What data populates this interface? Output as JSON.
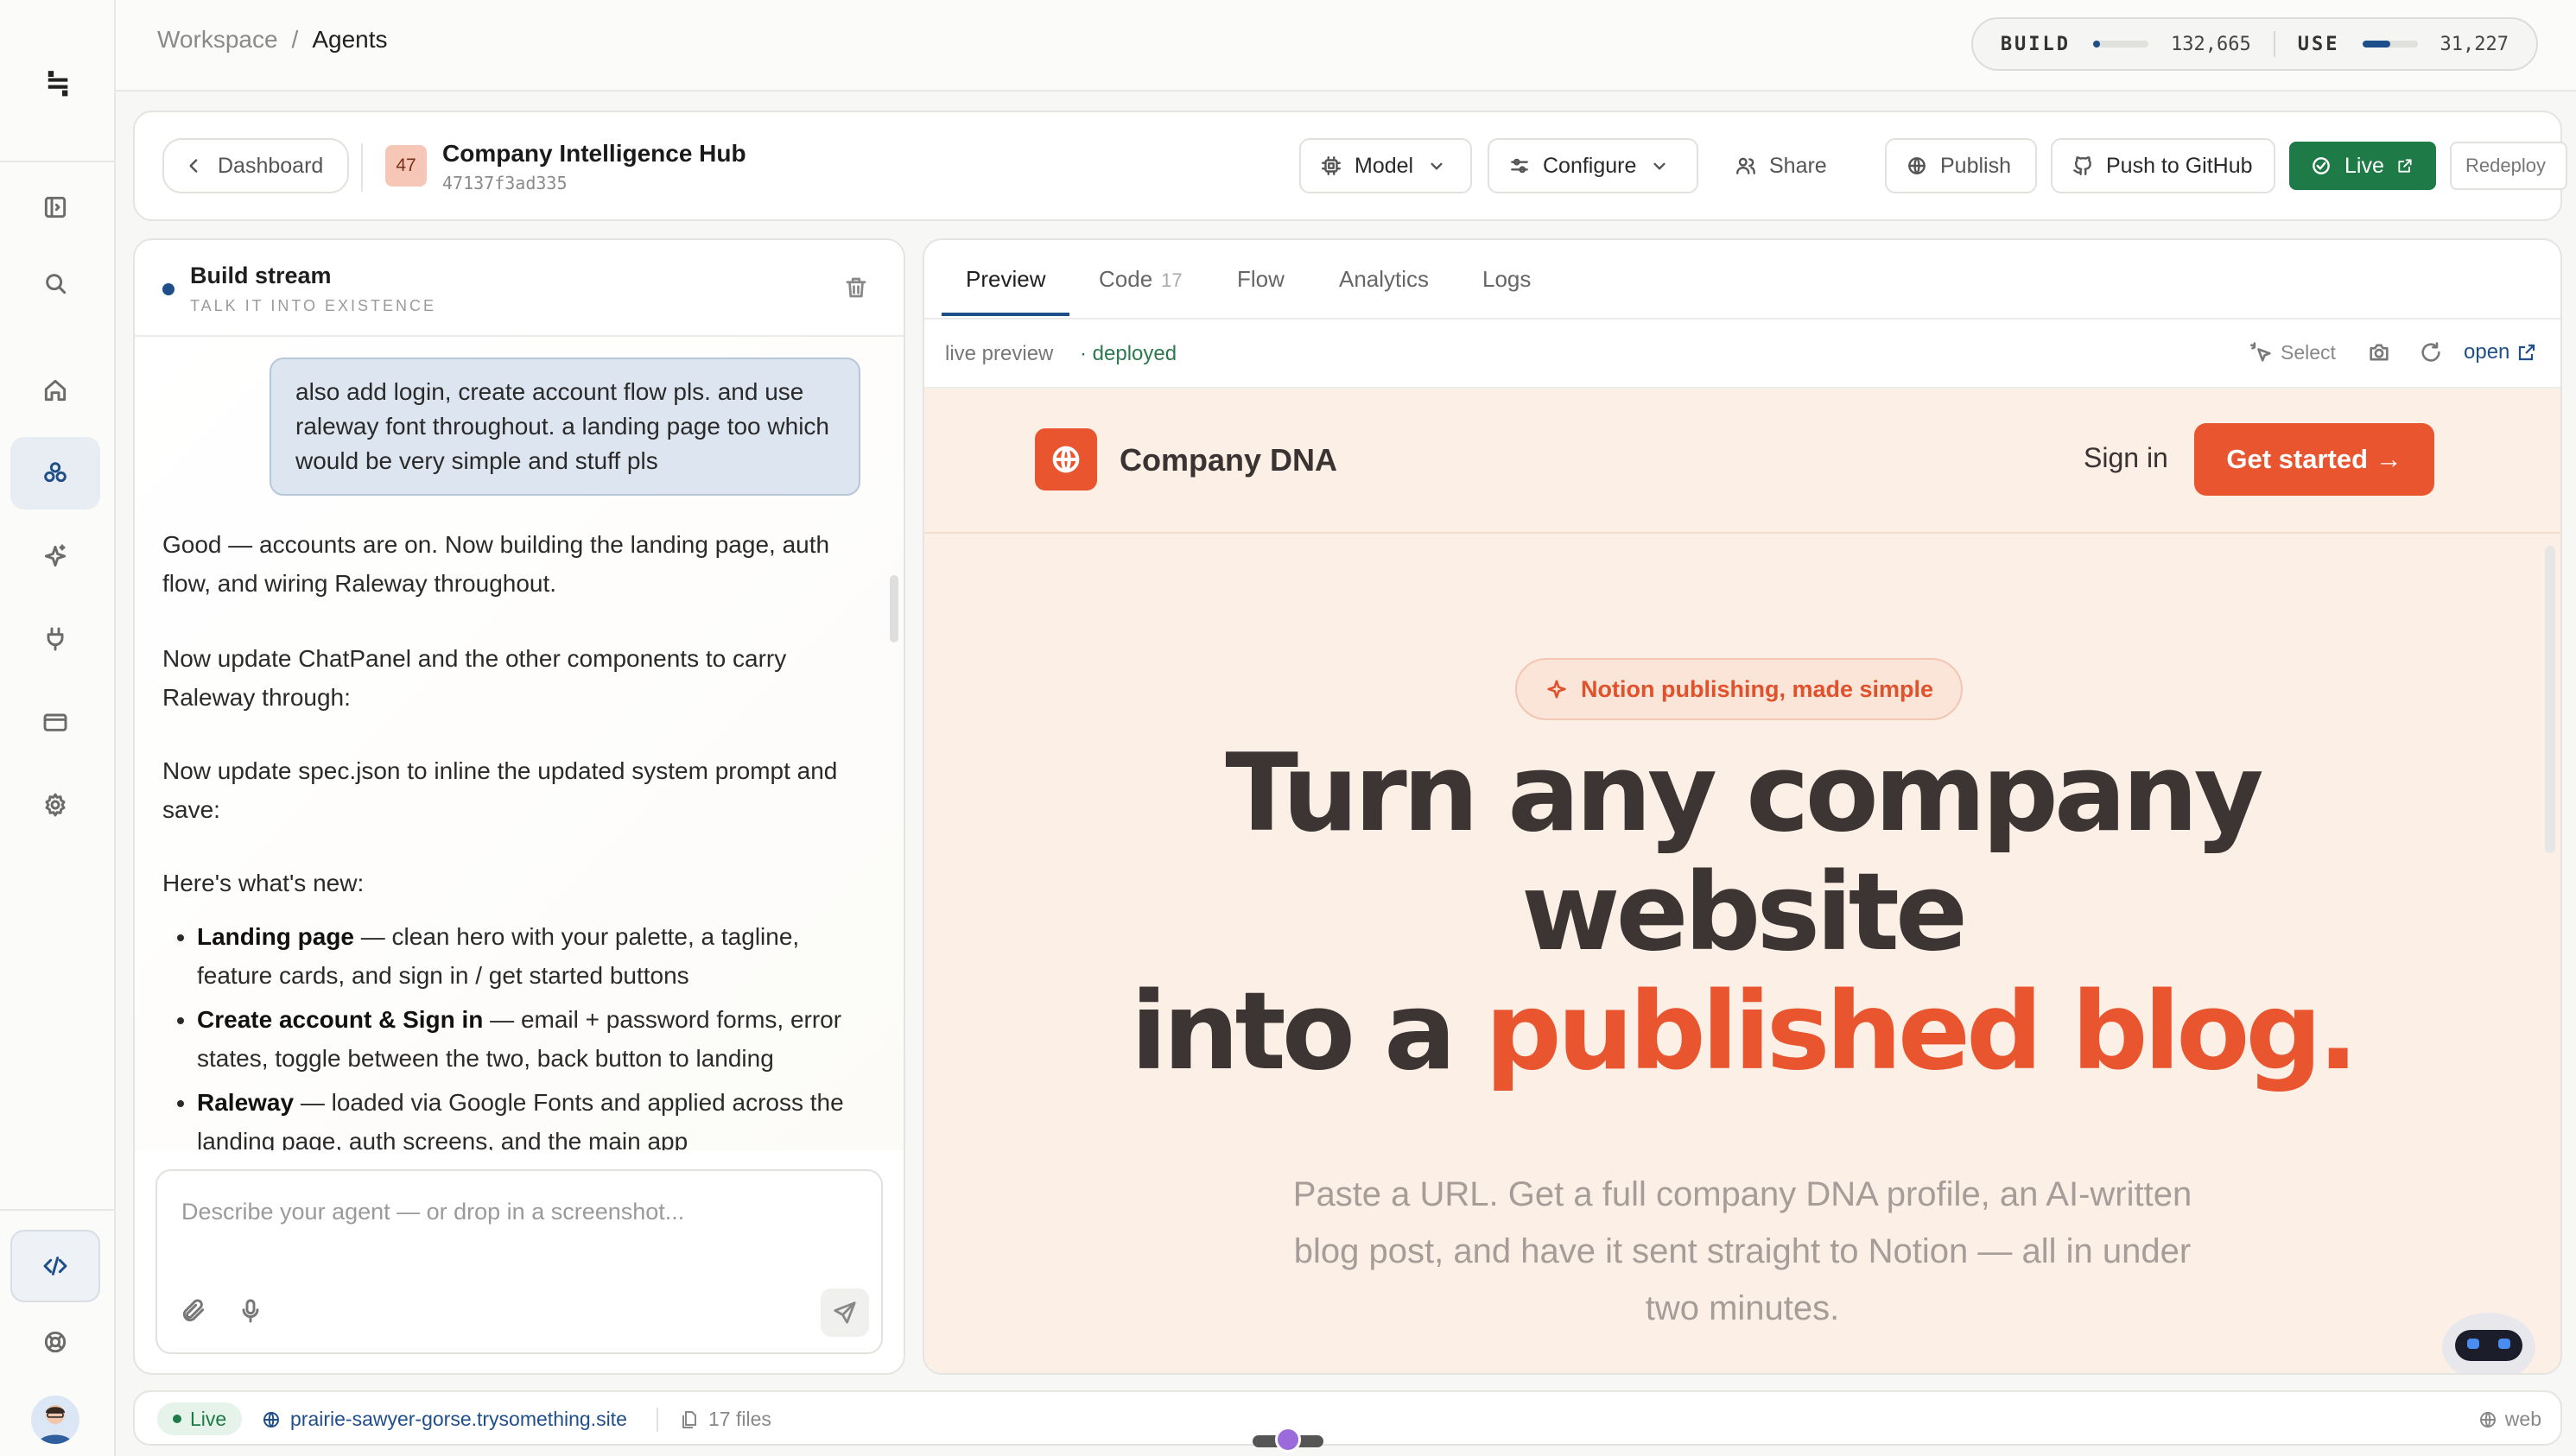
{
  "topbar": {
    "breadcrumb": [
      "Workspace",
      "/",
      "Agents"
    ],
    "build_label": "BUILD",
    "build_value": "132,665",
    "build_fill": 0.12,
    "use_label": "USE",
    "use_value": "31,227",
    "use_fill": 0.5
  },
  "header": {
    "back_label": "Dashboard",
    "badge": "47",
    "title": "Company Intelligence Hub",
    "id": "47137f3ad335",
    "model_label": "Model",
    "configure_label": "Configure",
    "share_label": "Share",
    "publish_label": "Publish",
    "github_label": "Push to GitHub",
    "live_label": "Live",
    "redeploy_label": "Redeploy"
  },
  "chat": {
    "title": "Build stream",
    "subtitle": "TALK IT INTO EXISTENCE",
    "user_message": "also add login, create account flow pls. and use raleway font throughout. a landing page too which would be very simple and stuff pls",
    "p1": "Good — accounts are on. Now building the landing page, auth flow, and wiring Raleway throughout.",
    "p2": "Now update ChatPanel and the other components to carry Raleway through:",
    "p3": "Now update spec.json to inline the updated system prompt and save:",
    "p4": "Here's what's new:",
    "bullets": [
      {
        "title": "Landing page",
        "text": " — clean hero with your palette, a tagline, feature cards, and sign in / get started buttons"
      },
      {
        "title": "Create account & Sign in",
        "text": " — email + password forms, error states, toggle between the two, back button to landing"
      },
      {
        "title": "Raleway",
        "text": " — loaded via Google Fonts and applied across the landing page, auth screens, and the main app"
      }
    ],
    "composer_placeholder": "Describe your agent — or drop in a screenshot..."
  },
  "preview": {
    "tabs": [
      "Preview",
      "Code",
      "Flow",
      "Analytics",
      "Logs"
    ],
    "code_count": "17",
    "live_preview": "live preview",
    "deployed": "· deployed",
    "select_label": "Select",
    "open_label": "open"
  },
  "site": {
    "brand": "Company DNA",
    "sign_in": "Sign in",
    "get_started": "Get started →",
    "pill": "Notion publishing, made simple",
    "hero_line1": "Turn any company",
    "hero_line2": "website",
    "hero_line3a": "into a ",
    "hero_line3b": "published blog.",
    "subhero": "Paste a URL. Get a full company DNA profile, an AI-written blog post, and have it sent straight to Notion — all in under two minutes."
  },
  "footer": {
    "live": "Live",
    "url": "prairie-sawyer-gorse.trysomething.site",
    "files": "17 files",
    "env": "web"
  },
  "colors": {
    "accent_blue": "#1f4f8a",
    "live_green": "#1e7a46",
    "brand_orange": "#e8552e"
  },
  "icons": [
    "logo-icon",
    "panel-icon",
    "search-icon",
    "home-icon",
    "agents-icon",
    "sparkle-icon",
    "plug-icon",
    "card-icon",
    "gear-icon",
    "code-icon",
    "help-icon"
  ]
}
